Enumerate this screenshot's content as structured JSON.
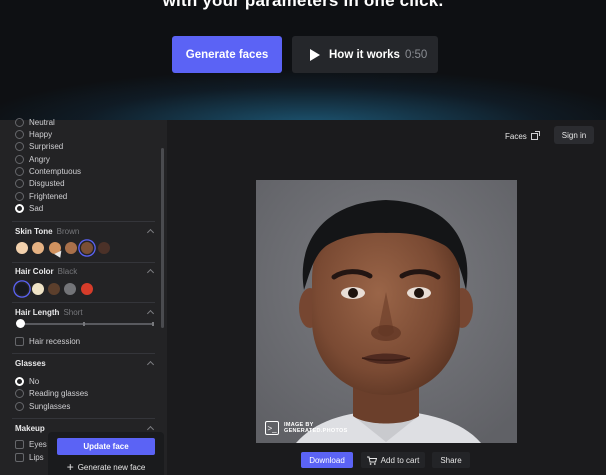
{
  "hero": {
    "headline": "with your parameters in one click.",
    "generate_label": "Generate faces",
    "how_label": "How it works",
    "how_duration": "0:50"
  },
  "emotion": {
    "options": [
      "Neutral",
      "Happy",
      "Surprised",
      "Angry",
      "Contemptuous",
      "Disgusted",
      "Frightened",
      "Sad"
    ],
    "selected": "Sad"
  },
  "skin_tone": {
    "title": "Skin Tone",
    "value": "Brown",
    "swatches": [
      "#f3d1ad",
      "#e6b283",
      "#d1925f",
      "#a9704a",
      "#7a4f36",
      "#4b3128"
    ],
    "selected_index": 4
  },
  "hair_color": {
    "title": "Hair Color",
    "value": "Black",
    "swatches": [
      "#181a1f",
      "#efe3c6",
      "#5c3f2c",
      "#737478",
      "#d63c2a"
    ],
    "selected_index": 0
  },
  "hair_length": {
    "title": "Hair Length",
    "value": "Short",
    "level": 0,
    "recession_label": "Hair recession"
  },
  "glasses": {
    "title": "Glasses",
    "options": [
      "No",
      "Reading glasses",
      "Sunglasses"
    ],
    "selected": "No"
  },
  "makeup": {
    "title": "Makeup",
    "options": [
      "Eyes",
      "Lips"
    ]
  },
  "actions": {
    "update_label": "Update face",
    "new_face_label": "Generate new face"
  },
  "header": {
    "faces_label": "Faces",
    "signin_label": "Sign in"
  },
  "photo": {
    "watermark_line1": "IMAGE BY",
    "watermark_line2": "GENERATED.PHOTOS"
  },
  "bottom": {
    "download_label": "Download",
    "cart_label": "Add to cart",
    "share_label": "Share"
  },
  "colors": {
    "accent": "#5b63f5",
    "panel": "#232325",
    "background": "#1b1b1d"
  }
}
